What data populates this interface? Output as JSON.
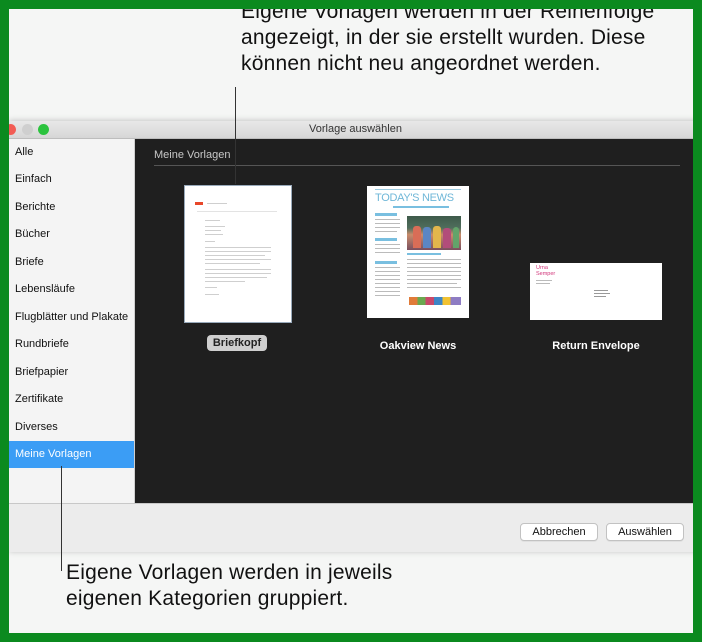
{
  "window": {
    "title": "Vorlage auswählen"
  },
  "sidebar": {
    "items": [
      {
        "label": "Alle"
      },
      {
        "label": "Einfach"
      },
      {
        "label": "Berichte"
      },
      {
        "label": "Bücher"
      },
      {
        "label": "Briefe"
      },
      {
        "label": "Lebensläufe"
      },
      {
        "label": "Flugblätter und Plakate"
      },
      {
        "label": "Rundbriefe"
      },
      {
        "label": "Briefpapier"
      },
      {
        "label": "Zertifikate"
      },
      {
        "label": "Diverses"
      },
      {
        "label": "Meine Vorlagen"
      }
    ],
    "selected": "Meine Vorlagen"
  },
  "main": {
    "section_label": "Meine Vorlagen",
    "templates": [
      {
        "name": "Briefkopf",
        "selected": true
      },
      {
        "name": "Oakview News",
        "selected": false,
        "headline": "TODAY'S NEWS"
      },
      {
        "name": "Return Envelope",
        "selected": false,
        "sender": "Urna Semper"
      }
    ]
  },
  "buttons": {
    "cancel": "Abbrechen",
    "choose": "Auswählen"
  },
  "callouts": {
    "top": "Eigene Vorlagen werden in der Reihenfolge angezeigt, in der sie erstellt wurden. Diese können nicht neu angeordnet werden.",
    "bottom": "Eigene Vorlagen werden in jeweils eigenen Kategorien gruppiert."
  },
  "colors": {
    "frame": "#0b8a1f",
    "selection": "#3b9df5",
    "content_bg": "#1f1f1f"
  }
}
